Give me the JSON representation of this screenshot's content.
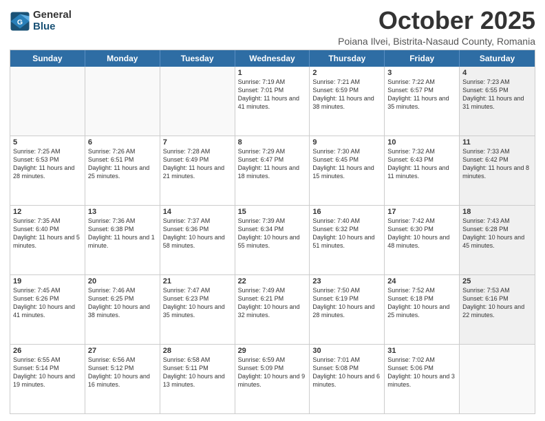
{
  "logo": {
    "general": "General",
    "blue": "Blue"
  },
  "title": "October 2025",
  "location": "Poiana Ilvei, Bistrita-Nasaud County, Romania",
  "days": [
    "Sunday",
    "Monday",
    "Tuesday",
    "Wednesday",
    "Thursday",
    "Friday",
    "Saturday"
  ],
  "weeks": [
    [
      {
        "day": "",
        "text": "",
        "empty": true
      },
      {
        "day": "",
        "text": "",
        "empty": true
      },
      {
        "day": "",
        "text": "",
        "empty": true
      },
      {
        "day": "1",
        "text": "Sunrise: 7:19 AM\nSunset: 7:01 PM\nDaylight: 11 hours and 41 minutes."
      },
      {
        "day": "2",
        "text": "Sunrise: 7:21 AM\nSunset: 6:59 PM\nDaylight: 11 hours and 38 minutes."
      },
      {
        "day": "3",
        "text": "Sunrise: 7:22 AM\nSunset: 6:57 PM\nDaylight: 11 hours and 35 minutes."
      },
      {
        "day": "4",
        "text": "Sunrise: 7:23 AM\nSunset: 6:55 PM\nDaylight: 11 hours and 31 minutes.",
        "shaded": true
      }
    ],
    [
      {
        "day": "5",
        "text": "Sunrise: 7:25 AM\nSunset: 6:53 PM\nDaylight: 11 hours and 28 minutes."
      },
      {
        "day": "6",
        "text": "Sunrise: 7:26 AM\nSunset: 6:51 PM\nDaylight: 11 hours and 25 minutes."
      },
      {
        "day": "7",
        "text": "Sunrise: 7:28 AM\nSunset: 6:49 PM\nDaylight: 11 hours and 21 minutes."
      },
      {
        "day": "8",
        "text": "Sunrise: 7:29 AM\nSunset: 6:47 PM\nDaylight: 11 hours and 18 minutes."
      },
      {
        "day": "9",
        "text": "Sunrise: 7:30 AM\nSunset: 6:45 PM\nDaylight: 11 hours and 15 minutes."
      },
      {
        "day": "10",
        "text": "Sunrise: 7:32 AM\nSunset: 6:43 PM\nDaylight: 11 hours and 11 minutes."
      },
      {
        "day": "11",
        "text": "Sunrise: 7:33 AM\nSunset: 6:42 PM\nDaylight: 11 hours and 8 minutes.",
        "shaded": true
      }
    ],
    [
      {
        "day": "12",
        "text": "Sunrise: 7:35 AM\nSunset: 6:40 PM\nDaylight: 11 hours and 5 minutes."
      },
      {
        "day": "13",
        "text": "Sunrise: 7:36 AM\nSunset: 6:38 PM\nDaylight: 11 hours and 1 minute."
      },
      {
        "day": "14",
        "text": "Sunrise: 7:37 AM\nSunset: 6:36 PM\nDaylight: 10 hours and 58 minutes."
      },
      {
        "day": "15",
        "text": "Sunrise: 7:39 AM\nSunset: 6:34 PM\nDaylight: 10 hours and 55 minutes."
      },
      {
        "day": "16",
        "text": "Sunrise: 7:40 AM\nSunset: 6:32 PM\nDaylight: 10 hours and 51 minutes."
      },
      {
        "day": "17",
        "text": "Sunrise: 7:42 AM\nSunset: 6:30 PM\nDaylight: 10 hours and 48 minutes."
      },
      {
        "day": "18",
        "text": "Sunrise: 7:43 AM\nSunset: 6:28 PM\nDaylight: 10 hours and 45 minutes.",
        "shaded": true
      }
    ],
    [
      {
        "day": "19",
        "text": "Sunrise: 7:45 AM\nSunset: 6:26 PM\nDaylight: 10 hours and 41 minutes."
      },
      {
        "day": "20",
        "text": "Sunrise: 7:46 AM\nSunset: 6:25 PM\nDaylight: 10 hours and 38 minutes."
      },
      {
        "day": "21",
        "text": "Sunrise: 7:47 AM\nSunset: 6:23 PM\nDaylight: 10 hours and 35 minutes."
      },
      {
        "day": "22",
        "text": "Sunrise: 7:49 AM\nSunset: 6:21 PM\nDaylight: 10 hours and 32 minutes."
      },
      {
        "day": "23",
        "text": "Sunrise: 7:50 AM\nSunset: 6:19 PM\nDaylight: 10 hours and 28 minutes."
      },
      {
        "day": "24",
        "text": "Sunrise: 7:52 AM\nSunset: 6:18 PM\nDaylight: 10 hours and 25 minutes."
      },
      {
        "day": "25",
        "text": "Sunrise: 7:53 AM\nSunset: 6:16 PM\nDaylight: 10 hours and 22 minutes.",
        "shaded": true
      }
    ],
    [
      {
        "day": "26",
        "text": "Sunrise: 6:55 AM\nSunset: 5:14 PM\nDaylight: 10 hours and 19 minutes."
      },
      {
        "day": "27",
        "text": "Sunrise: 6:56 AM\nSunset: 5:12 PM\nDaylight: 10 hours and 16 minutes."
      },
      {
        "day": "28",
        "text": "Sunrise: 6:58 AM\nSunset: 5:11 PM\nDaylight: 10 hours and 13 minutes."
      },
      {
        "day": "29",
        "text": "Sunrise: 6:59 AM\nSunset: 5:09 PM\nDaylight: 10 hours and 9 minutes."
      },
      {
        "day": "30",
        "text": "Sunrise: 7:01 AM\nSunset: 5:08 PM\nDaylight: 10 hours and 6 minutes."
      },
      {
        "day": "31",
        "text": "Sunrise: 7:02 AM\nSunset: 5:06 PM\nDaylight: 10 hours and 3 minutes."
      },
      {
        "day": "",
        "text": "",
        "empty": true,
        "shaded": true
      }
    ]
  ]
}
